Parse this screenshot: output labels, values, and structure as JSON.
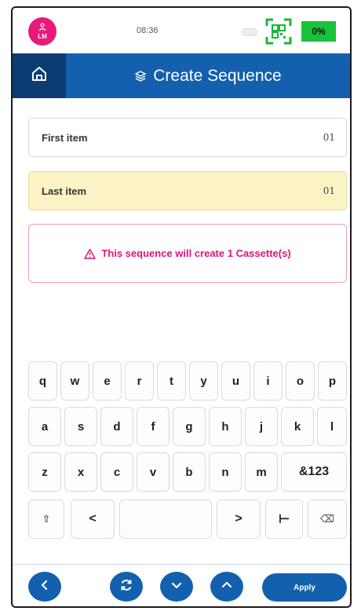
{
  "status_bar": {
    "user_initials": "LM",
    "time": "08:36",
    "battery": "0%"
  },
  "header": {
    "title": "Create Sequence"
  },
  "fields": {
    "first": {
      "label": "First item",
      "value": "01"
    },
    "last": {
      "label": "Last item",
      "value": "01"
    }
  },
  "alert": {
    "message": "This sequence will create 1 Cassette(s)"
  },
  "keyboard": {
    "row1": [
      "q",
      "w",
      "e",
      "r",
      "t",
      "y",
      "u",
      "i",
      "o",
      "p"
    ],
    "row2": [
      "a",
      "s",
      "d",
      "f",
      "g",
      "h",
      "j",
      "k",
      "l"
    ],
    "row3": [
      "z",
      "x",
      "c",
      "v",
      "b",
      "n",
      "m",
      "&123"
    ],
    "row4": {
      "shift_glyph": "⇧",
      "left_glyph": "<",
      "space": "",
      "right_glyph": ">",
      "tab_glyph": "⊢",
      "backspace_glyph": "⌫"
    }
  },
  "bottom_bar": {
    "apply_label": "Apply"
  },
  "colors": {
    "brand_blue": "#1360ae",
    "header_dark": "#0b3d73",
    "alert_pink": "#e0127a",
    "battery_green": "#19c23b",
    "last_item_bg": "#fbf3c4"
  },
  "icons": {
    "avatar": "user-icon",
    "scanner": "qr-scan-icon",
    "home": "home-icon",
    "title": "layers-icon",
    "alert": "warning-triangle-icon",
    "back": "chevron-left-icon",
    "refresh": "refresh-icon",
    "down": "chevron-down-icon",
    "up": "chevron-up-icon"
  }
}
